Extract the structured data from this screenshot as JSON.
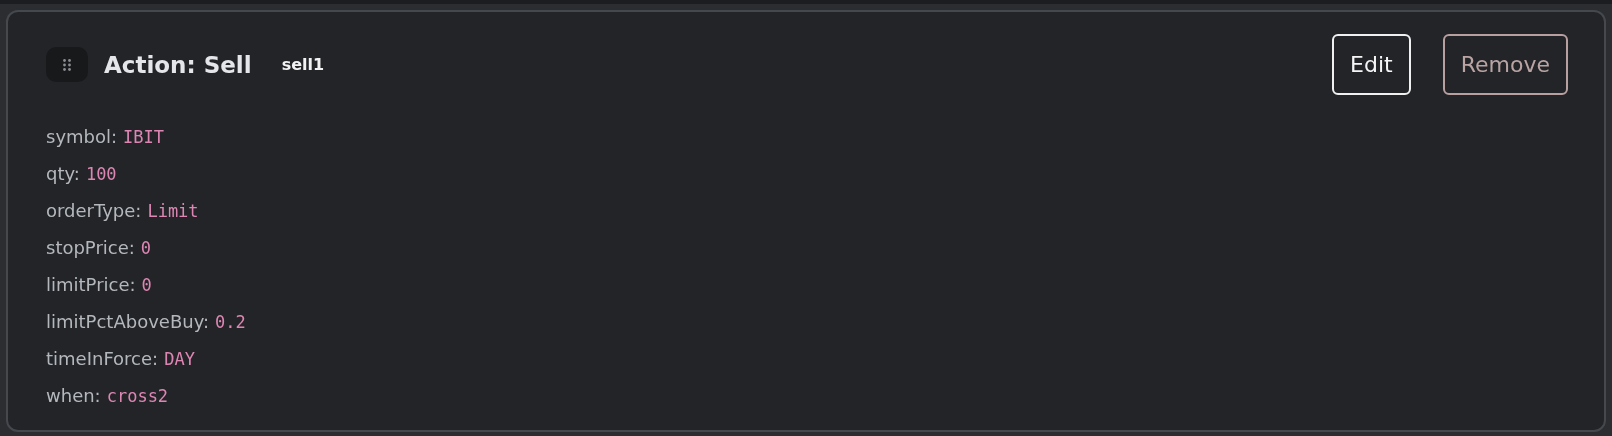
{
  "card": {
    "title": "Action: Sell",
    "tag": "sell1",
    "buttons": [
      {
        "label": "Edit",
        "kind": "primary"
      },
      {
        "label": "Remove",
        "kind": "danger"
      }
    ],
    "fields": [
      {
        "key": "symbol:",
        "value": "IBIT"
      },
      {
        "key": "qty:",
        "value": "100"
      },
      {
        "key": "orderType:",
        "value": "Limit"
      },
      {
        "key": "stopPrice:",
        "value": "0"
      },
      {
        "key": "limitPrice:",
        "value": "0"
      },
      {
        "key": "limitPctAboveBuy:",
        "value": "0.2"
      },
      {
        "key": "timeInForce:",
        "value": "DAY"
      },
      {
        "key": "when:",
        "value": "cross2"
      }
    ]
  }
}
